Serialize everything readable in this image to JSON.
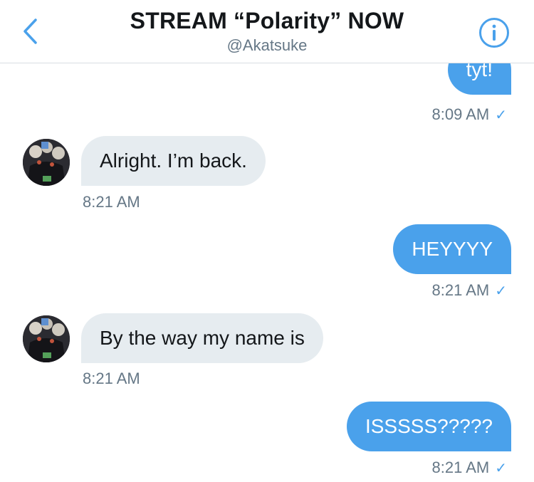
{
  "header": {
    "title": "STREAM “Polarity” NOW",
    "handle": "@Akatsuke",
    "back_icon": "chevron-left-icon",
    "info_icon": "info-icon",
    "accent_color": "#4aa1eb"
  },
  "messages": [
    {
      "direction": "out",
      "text": "tyt!",
      "time": "8:09 AM",
      "read_icon": "✓"
    },
    {
      "direction": "in",
      "text": "Alright. I’m back.",
      "time": "8:21 AM"
    },
    {
      "direction": "out",
      "text": "HEYYYY",
      "time": "8:21 AM",
      "read_icon": "✓"
    },
    {
      "direction": "in",
      "text": "By the way my name is",
      "time": "8:21 AM"
    },
    {
      "direction": "out",
      "text": "ISSSSS?????",
      "time": "8:21 AM",
      "read_icon": "✓"
    }
  ]
}
